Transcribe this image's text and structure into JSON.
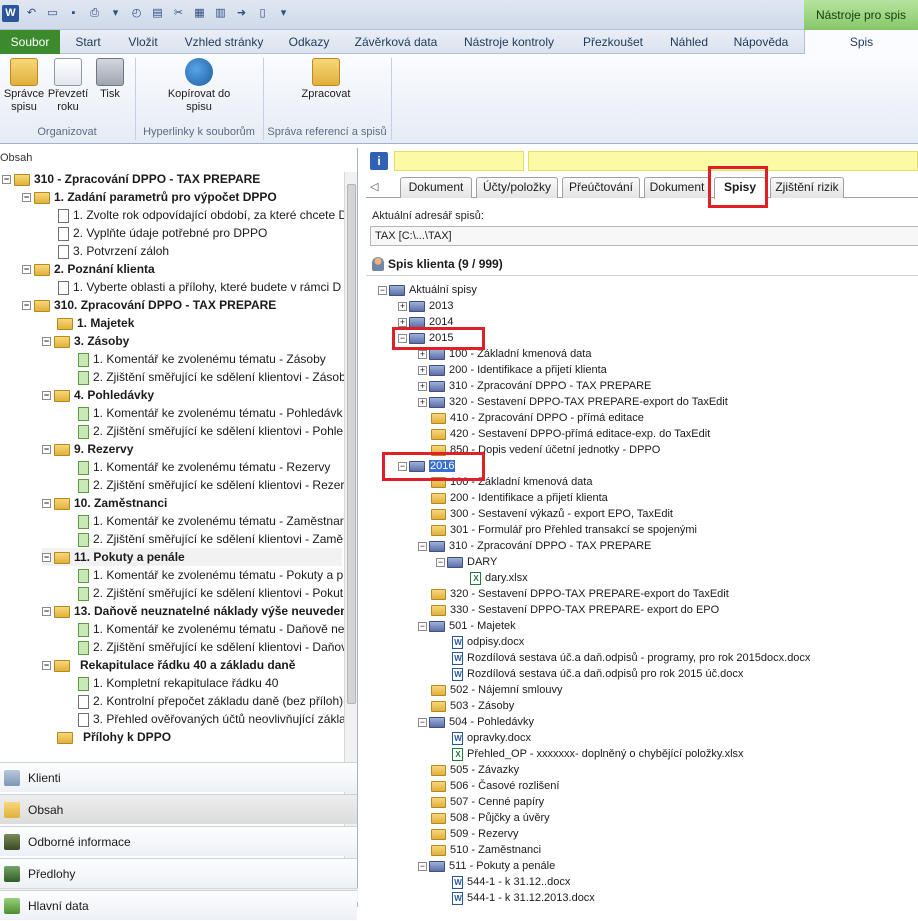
{
  "ribbon": {
    "tools_tab": "Nástroje pro spis",
    "tabs": [
      "Soubor",
      "Start",
      "Vložit",
      "Vzhled stránky",
      "Odkazy",
      "Závěrková data",
      "Nástroje kontroly",
      "Přezkoušet",
      "Náhled",
      "Nápověda",
      "Spis"
    ],
    "buttons": {
      "spravce": "Správce spisu",
      "prevzeti": "Převzetí roku",
      "tisk": "Tisk",
      "kopirovat": "Kopírovat do spisu",
      "zpracovat": "Zpracovat"
    },
    "groups": [
      "Organizovat",
      "Hyperlinky k souborům",
      "Správa referencí a spisů"
    ]
  },
  "left": {
    "header": "Obsah",
    "tree": [
      {
        "text": "310 - Zpracování DPPO - TAX PREPARE",
        "bold": true
      },
      {
        "text": "1. Zadání parametrů pro výpočet DPPO",
        "bold": true
      },
      {
        "text": "1. Zvolte rok odpovídající období, za které chcete D",
        "bold": false
      },
      {
        "text": "2. Vyplňte údaje potřebné pro DPPO",
        "bold": false
      },
      {
        "text": "3. Potvrzení záloh",
        "bold": false
      },
      {
        "text": "2. Poznání klienta",
        "bold": true
      },
      {
        "text": "1. Vyberte oblasti a přílohy, které budete v rámci D",
        "bold": false
      },
      {
        "text": "310. Zpracování DPPO - TAX PREPARE",
        "bold": true
      },
      {
        "text": "1. Majetek",
        "bold": true
      },
      {
        "text": "3. Zásoby",
        "bold": true
      },
      {
        "text": "1. Komentář ke zvolenému tématu - Zásoby",
        "bold": false
      },
      {
        "text": "2. Zjištění směřující ke sdělení klientovi - Zásob",
        "bold": false
      },
      {
        "text": "4. Pohledávky",
        "bold": true
      },
      {
        "text": "1. Komentář ke zvolenému tématu - Pohledávk",
        "bold": false
      },
      {
        "text": "2. Zjištění směřující ke sdělení klientovi - Pohle",
        "bold": false
      },
      {
        "text": "9. Rezervy",
        "bold": true
      },
      {
        "text": "1. Komentář ke zvolenému tématu  - Rezervy",
        "bold": false
      },
      {
        "text": "2. Zjištění směřující ke sdělení klientovi - Rezer",
        "bold": false
      },
      {
        "text": "10. Zaměstnanci",
        "bold": true
      },
      {
        "text": "1. Komentář ke zvolenému tématu - Zaměstnar",
        "bold": false
      },
      {
        "text": "2. Zjištění směřující ke sdělení klientovi - Zamě",
        "bold": false
      },
      {
        "text": "11. Pokuty a penále",
        "bold": true
      },
      {
        "text": "1. Komentář ke zvolenému tématu - Pokuty a p",
        "bold": false
      },
      {
        "text": "2. Zjištění směřující ke sdělení klientovi - Pokut",
        "bold": false
      },
      {
        "text": "13. Daňově neuznatelné náklady výše neuveden",
        "bold": true
      },
      {
        "text": "1. Komentář ke zvolenému tématu - Daňově ne",
        "bold": false
      },
      {
        "text": "2. Zjištění směřující ke sdělení klientovi - Daňov",
        "bold": false
      },
      {
        "text": "Rekapitulace řádku 40 a základu daně",
        "bold": true
      },
      {
        "text": "1. Kompletní rekapitulace řádku 40",
        "bold": false
      },
      {
        "text": "2. Kontrolní přepočet základu daně (bez příloh)",
        "bold": false
      },
      {
        "text": "3. Přehled ověřovaných účtů neovlivňující zákla",
        "bold": false
      },
      {
        "text": "Přílohy k DPPO",
        "bold": true
      }
    ],
    "nav": [
      "Klienti",
      "Obsah",
      "Odborné informace",
      "Předlohy",
      "Hlavní data"
    ]
  },
  "right": {
    "doc_tabs": [
      "Dokument",
      "Účty/položky",
      "Přeúčtování",
      "Dokument",
      "Spisy",
      "Zjištění rizik"
    ],
    "path_label": "Aktuální adresář spisů:",
    "path_value": "TAX [C:\\...\\TAX]",
    "spis_header": "Spis klienta (9 / 999)",
    "tree": [
      {
        "text": "Aktuální spisy"
      },
      {
        "text": "2013"
      },
      {
        "text": "2014"
      },
      {
        "text": "2015"
      },
      {
        "text": "100 - Základní kmenová data"
      },
      {
        "text": "200 - Identifikace a přijetí klienta"
      },
      {
        "text": "310 - Zpracování DPPO - TAX PREPARE"
      },
      {
        "text": "320 - Sestavení DPPO-TAX PREPARE-export do TaxEdit"
      },
      {
        "text": "410 - Zpracování DPPO - přímá editace"
      },
      {
        "text": "420 - Sestavení DPPO-přímá editace-exp. do TaxEdit"
      },
      {
        "text": "850 - Dopis vedení účetní jednotky - DPPO"
      },
      {
        "text": "2016"
      },
      {
        "text": "100 - Základní kmenová data"
      },
      {
        "text": "200 - Identifikace a přijetí klienta"
      },
      {
        "text": "300 - Sestavení výkazů - export EPO, TaxEdit"
      },
      {
        "text": "301 - Formulář pro Přehled transakcí se spojenými"
      },
      {
        "text": "310 - Zpracování DPPO - TAX PREPARE"
      },
      {
        "text": "DARY"
      },
      {
        "text": "dary.xlsx"
      },
      {
        "text": "320 - Sestavení DPPO-TAX PREPARE-export do TaxEdit"
      },
      {
        "text": "330 - Sestavení DPPO-TAX PREPARE- export do EPO"
      },
      {
        "text": "501 - Majetek"
      },
      {
        "text": "odpisy.docx"
      },
      {
        "text": "Rozdílová sestava úč.a daň.odpisů - programy, pro rok 2015docx.docx"
      },
      {
        "text": "Rozdílová sestava úč.a daň.odpisů pro rok 2015 úč.docx"
      },
      {
        "text": "502 - Nájemní smlouvy"
      },
      {
        "text": "503 - Zásoby"
      },
      {
        "text": "504 - Pohledávky"
      },
      {
        "text": "opravky.docx"
      },
      {
        "text": "Přehled_OP - xxxxxxx- doplněný o chybějící položky.xlsx"
      },
      {
        "text": "505 - Závazky"
      },
      {
        "text": "506 - Časové rozlišení"
      },
      {
        "text": "507 - Cenné papíry"
      },
      {
        "text": "508 - Půjčky a úvěry"
      },
      {
        "text": "509 - Rezervy"
      },
      {
        "text": "510 - Zaměstnanci"
      },
      {
        "text": "511 - Pokuty a penále"
      },
      {
        "text": "544-1 - k 31.12..docx"
      },
      {
        "text": "544-1 - k 31.12.2013.docx"
      }
    ]
  },
  "colors": {
    "accent_green": "#3c8a2e",
    "highlight_red": "#e01f26",
    "selection_blue": "#3a6fd0"
  }
}
